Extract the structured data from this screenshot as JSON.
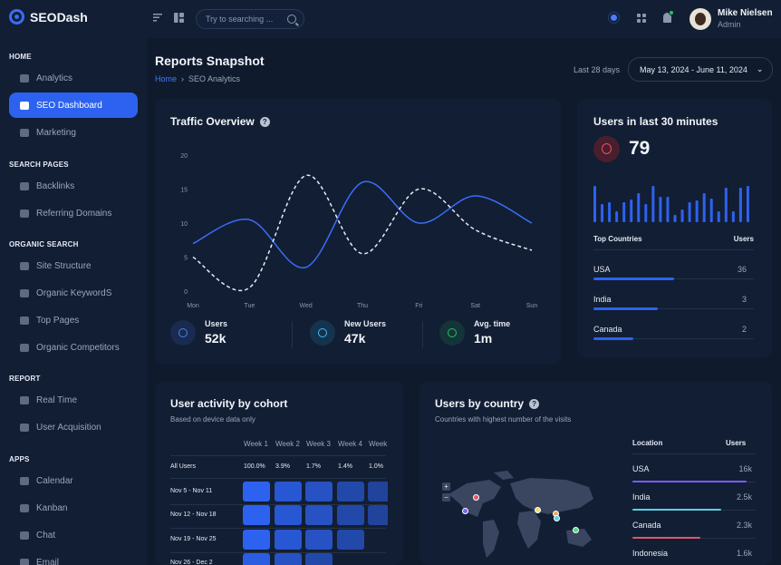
{
  "app": {
    "name": "SEODash"
  },
  "header": {
    "search_placeholder": "Try to searching ...",
    "user": {
      "name": "Mike Nielsen",
      "role": "Admin"
    }
  },
  "sidebar": {
    "sections": [
      {
        "title": "HOME",
        "items": [
          {
            "label": "Analytics",
            "icon": "bar-chart-icon"
          },
          {
            "label": "SEO Dashboard",
            "icon": "dashboard-icon",
            "active": true
          },
          {
            "label": "Marketing",
            "icon": "chart-line-icon"
          }
        ]
      },
      {
        "title": "SEARCH PAGES",
        "items": [
          {
            "label": "Backlinks",
            "icon": "link-icon"
          },
          {
            "label": "Referring Domains",
            "icon": "domain-icon"
          }
        ]
      },
      {
        "title": "ORGANIC SEARCH",
        "items": [
          {
            "label": "Site Structure",
            "icon": "layers-icon"
          },
          {
            "label": "Organic KeywordS",
            "icon": "keyword-icon"
          },
          {
            "label": "Top Pages",
            "icon": "pages-icon"
          },
          {
            "label": "Organic Competitors",
            "icon": "competitors-icon"
          }
        ]
      },
      {
        "title": "REPORT",
        "items": [
          {
            "label": "Real Time",
            "icon": "clock-icon"
          },
          {
            "label": "User Acquisition",
            "icon": "users-icon"
          }
        ]
      },
      {
        "title": "APPS",
        "items": [
          {
            "label": "Calendar",
            "icon": "calendar-icon"
          },
          {
            "label": "Kanban",
            "icon": "kanban-icon"
          },
          {
            "label": "Chat",
            "icon": "chat-icon"
          },
          {
            "label": "Email",
            "icon": "mail-icon"
          }
        ]
      }
    ]
  },
  "page": {
    "title": "Reports Snapshot",
    "breadcrumb": [
      "Home",
      "SEO Analytics"
    ],
    "range_label": "Last 28 days",
    "date_range": "May 13, 2024 - June 11, 2024"
  },
  "traffic": {
    "title": "Traffic Overview",
    "stats": [
      {
        "label": "Users",
        "value": "52k",
        "icon": "users-icon",
        "color": "#4d7cff"
      },
      {
        "label": "New Users",
        "value": "47k",
        "icon": "new-users-icon",
        "color": "#38bdf8"
      },
      {
        "label": "Avg. time",
        "value": "1m",
        "icon": "clock-icon",
        "color": "#22c55e"
      }
    ]
  },
  "chart_data": {
    "type": "line",
    "x": [
      "Mon",
      "Tue",
      "Wed",
      "Thu",
      "Fri",
      "Sat",
      "Sun"
    ],
    "yticks": [
      0,
      5,
      10,
      15,
      20
    ],
    "ylim": [
      0,
      20
    ],
    "series": [
      {
        "values": [
          7,
          10.5,
          3.5,
          16,
          10,
          14,
          10
        ],
        "color": "#3b6cf6",
        "style": "solid"
      },
      {
        "values": [
          5,
          0.5,
          17,
          5.5,
          15,
          9,
          6
        ],
        "color": "#e6ebf5",
        "style": "dashed"
      }
    ]
  },
  "realtime": {
    "title": "Users in last 30 minutes",
    "value": "79",
    "bars": [
      40,
      20,
      22,
      12,
      22,
      25,
      32,
      20,
      40,
      28,
      28,
      8,
      14,
      22,
      24,
      32,
      26,
      12,
      38,
      12,
      38,
      40
    ],
    "countries_header": [
      "Top Countries",
      "Users"
    ],
    "countries": [
      {
        "name": "USA",
        "value": "36",
        "share": 0.5
      },
      {
        "name": "India",
        "value": "3",
        "share": 0.4
      },
      {
        "name": "Canada",
        "value": "2",
        "share": 0.25
      }
    ]
  },
  "cohort": {
    "title": "User activity by cohort",
    "subtitle": "Based on device data only",
    "weeks": [
      "Week 1",
      "Week 2",
      "Week 3",
      "Week 4",
      "Week"
    ],
    "all_users": [
      "100.0%",
      "3.9%",
      "1.7%",
      "1.4%",
      "1.0%"
    ],
    "all_users_label": "All Users",
    "rows": [
      {
        "label": "Nov 5 - Nov 11",
        "levels": [
          1.0,
          0.8,
          0.7,
          0.5,
          0.4
        ]
      },
      {
        "label": "Nov 12 - Nov 18",
        "levels": [
          1.0,
          0.8,
          0.7,
          0.5,
          0.4
        ]
      },
      {
        "label": "Nov 19 - Nov 25",
        "levels": [
          1.0,
          0.8,
          0.7,
          0.5
        ]
      },
      {
        "label": "Nov 26 - Dec 2",
        "levels": [
          0.9,
          0.7,
          0.5
        ]
      }
    ]
  },
  "country": {
    "title": "Users by country",
    "subtitle": "Countries with highest number of the visits",
    "header": [
      "Location",
      "Users"
    ],
    "rows": [
      {
        "name": "USA",
        "value": "16k",
        "share": 0.93,
        "color": "#7c5cff"
      },
      {
        "name": "India",
        "value": "2.5k",
        "share": 0.72,
        "color": "#5ad1e6"
      },
      {
        "name": "Canada",
        "value": "2.3k",
        "share": 0.55,
        "color": "#e0566b"
      },
      {
        "name": "Indonesia",
        "value": "1.6k",
        "share": 0.4,
        "color": "#4ade80"
      }
    ],
    "zoom_in": "+",
    "zoom_out": "−"
  }
}
